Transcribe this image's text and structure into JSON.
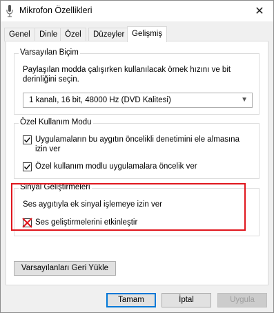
{
  "window": {
    "title": "Mikrofon Özellikleri",
    "close_glyph": "✕",
    "icon": "microphone-icon"
  },
  "tabs": [
    {
      "label": "Genel"
    },
    {
      "label": "Dinle"
    },
    {
      "label": "Özel"
    },
    {
      "label": "Düzeyler"
    },
    {
      "label": "Gelişmiş",
      "active": true
    }
  ],
  "default_format": {
    "legend": "Varsayılan Biçim",
    "description": "Paylaşılan modda çalışırken kullanılacak örnek hızını ve bit derinliğini seçin.",
    "selected": "1 kanalı, 16 bit, 48000 Hz (DVD Kalitesi)"
  },
  "exclusive_mode": {
    "legend": "Özel Kullanım Modu",
    "option1": {
      "label": "Uygulamaların bu aygıtın öncelikli denetimini ele almasına izin ver",
      "checked": true
    },
    "option2": {
      "label": "Özel kullanım modlu uygulamalara öncelik ver",
      "checked": true
    }
  },
  "signal_enhancements": {
    "legend": "Sinyal Geliştirmeleri",
    "info": "Ses aygıtıyla ek sinyal işlemeye izin ver",
    "option": {
      "label": "Ses geliştirmelerini etkinleştir",
      "checked": false
    }
  },
  "buttons": {
    "restore_defaults": "Varsayılanları Geri Yükle",
    "ok": "Tamam",
    "cancel": "İptal",
    "apply": "Uygula"
  },
  "colors": {
    "highlight_box": "#e0161d",
    "default_button_border": "#0078d7"
  }
}
